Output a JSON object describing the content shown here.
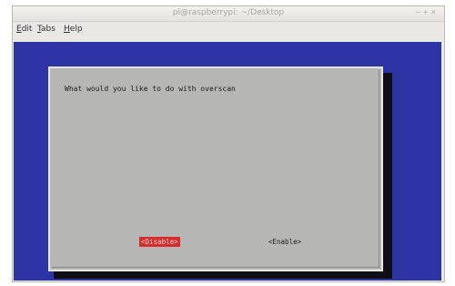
{
  "window": {
    "title": "pi@raspberrypi: ~/Desktop",
    "buttons": [
      "–",
      "+",
      "×"
    ]
  },
  "menu": [
    {
      "label": "Edit",
      "key": "E",
      "rest": "dit"
    },
    {
      "label": "Tabs",
      "key": "T",
      "rest": "abs"
    },
    {
      "label": "Help",
      "key": "H",
      "rest": "elp"
    }
  ],
  "dialog": {
    "prompt": "What would you like to do with overscan",
    "choices": [
      {
        "label": "<Disable>",
        "selected": true
      },
      {
        "label": "<Enable>",
        "selected": false
      }
    ]
  },
  "colors": {
    "terminal_bg": "#2d35a5",
    "dialog_bg": "#b6b6b4",
    "selected_bg": "#d62c2c",
    "shadow": "#0e0e14"
  }
}
